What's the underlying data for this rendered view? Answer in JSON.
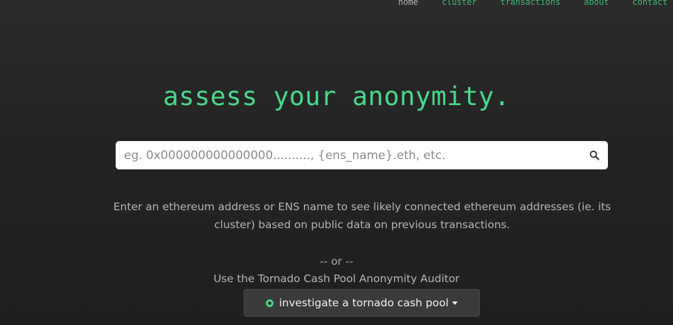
{
  "nav": {
    "items": [
      {
        "label": "home",
        "accent": false
      },
      {
        "label": "cluster",
        "accent": true
      },
      {
        "label": "transactions",
        "accent": true
      },
      {
        "label": "about",
        "accent": true
      },
      {
        "label": "contact",
        "accent": true
      }
    ]
  },
  "hero": {
    "title": "assess your anonymity."
  },
  "search": {
    "placeholder": "eg. 0x000000000000000.........., {ens_name}.eth, etc.",
    "value": "",
    "icon": "search-icon"
  },
  "description": "Enter an ethereum address or ENS name to see likely connected ethereum addresses (ie. its cluster) based on public data on previous transactions.",
  "divider": "-- or --",
  "auditor": {
    "text": "Use the Tornado Cash Pool Anonymity Auditor",
    "dropdown_label": "investigate a tornado cash pool",
    "dropdown_icon": "chevron-down-icon",
    "status_icon": "status-dot-icon"
  },
  "colors": {
    "accent": "#49d989",
    "background": "#252525",
    "text": "#b6b6b6",
    "dropdown_bg": "#3a3a3a"
  }
}
